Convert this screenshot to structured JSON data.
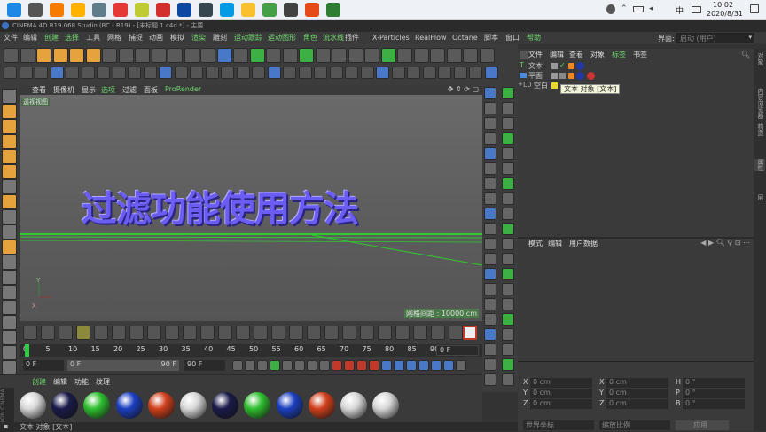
{
  "taskbar": {
    "apps": [
      {
        "name": "start-icon",
        "color": "#1e88e5"
      },
      {
        "name": "task-view-icon",
        "color": "#555555"
      },
      {
        "name": "app-orange-icon",
        "color": "#f57c00"
      },
      {
        "name": "folder-icon",
        "color": "#ffb300"
      },
      {
        "name": "user-icon",
        "color": "#607d8b"
      },
      {
        "name": "chrome-icon",
        "color": "#e53935"
      },
      {
        "name": "app-yellow-icon",
        "color": "#c0ca33"
      },
      {
        "name": "app-red-icon",
        "color": "#d32f2f"
      },
      {
        "name": "photoshop-icon",
        "color": "#0d47a1"
      },
      {
        "name": "app-c4d-icon",
        "color": "#37474f"
      },
      {
        "name": "edge-icon",
        "color": "#039be5"
      },
      {
        "name": "folder2-icon",
        "color": "#fbc02d"
      },
      {
        "name": "app-diamond-icon",
        "color": "#43a047"
      },
      {
        "name": "maps-icon",
        "color": "#424242"
      },
      {
        "name": "app-c-icon",
        "color": "#e64a19"
      },
      {
        "name": "wechat-icon",
        "color": "#2e7d32"
      }
    ],
    "ime": "中",
    "time": "10:02",
    "date": "2020/8/31"
  },
  "window_title": "CINEMA 4D R19.068 Studio (RC - R19) - [未标题 1.c4d *] - 主要",
  "menu": [
    "文件",
    "编辑",
    "创建",
    "选择",
    "工具",
    "网格",
    "捕捉",
    "动画",
    "模拟",
    "渲染",
    "雕刻",
    "运动跟踪",
    "运动图形",
    "角色",
    "流水线",
    "插件",
    "X-Particles",
    "RealFlow",
    "Octane",
    "脚本",
    "窗口",
    "帮助"
  ],
  "layout_label": "界面:",
  "layout_value": "启动 (用户)",
  "viewport": {
    "menu": [
      "查看",
      "摄像机",
      "显示",
      "选项",
      "过滤",
      "面板",
      "ProRender"
    ],
    "camera_label": "透视视图",
    "text3d": "过滤功能使用方法",
    "grid_info": "网格间距 : 10000 cm"
  },
  "objects_panel": {
    "menu": [
      "文件",
      "编辑",
      "查看",
      "对象",
      "标签",
      "书签"
    ],
    "items": [
      "文本",
      "平面",
      "空白"
    ],
    "tooltip": "文本 对象 [文本]"
  },
  "attributes_panel": {
    "menu": [
      "模式",
      "编辑",
      "用户数据"
    ]
  },
  "right_tabs": [
    "对象",
    "内容浏览器",
    "构造",
    "属性",
    "层"
  ],
  "timeline": {
    "ticks": [
      "0",
      "5",
      "10",
      "15",
      "20",
      "25",
      "30",
      "35",
      "40",
      "45",
      "50",
      "55",
      "60",
      "65",
      "70",
      "75",
      "80",
      "85",
      "90"
    ],
    "frame_end_label": "0 F",
    "current": "0 F",
    "range_start": "0 F",
    "range_end": "90 F",
    "max_frame": "90 F"
  },
  "materials": {
    "menu": [
      "创建",
      "编辑",
      "功能",
      "纹理"
    ],
    "balls": [
      "#d8d8d8",
      "#1a1a4a",
      "#2fbf2f",
      "#1c3fbf",
      "#d0401c",
      "#d8d8d8",
      "#1a1a4a",
      "#2fbf2f",
      "#1c3fbf",
      "#d0401c",
      "#d8d8d8",
      "#d8d8d8"
    ]
  },
  "coords": {
    "position": [
      {
        "axis": "X",
        "value": "0 cm"
      },
      {
        "axis": "Y",
        "value": "0 cm"
      },
      {
        "axis": "Z",
        "value": "0 cm"
      }
    ],
    "size": [
      {
        "axis": "X",
        "value": "0 cm"
      },
      {
        "axis": "Y",
        "value": "0 cm"
      },
      {
        "axis": "Z",
        "value": "0 cm"
      }
    ],
    "rotation": [
      {
        "axis": "H",
        "value": "0 °"
      },
      {
        "axis": "P",
        "value": "0 °"
      },
      {
        "axis": "B",
        "value": "0 °"
      }
    ],
    "mode1": "世界坐标",
    "mode2": "缩放比例",
    "apply": "应用"
  },
  "status": "文本 对象 [文本]"
}
